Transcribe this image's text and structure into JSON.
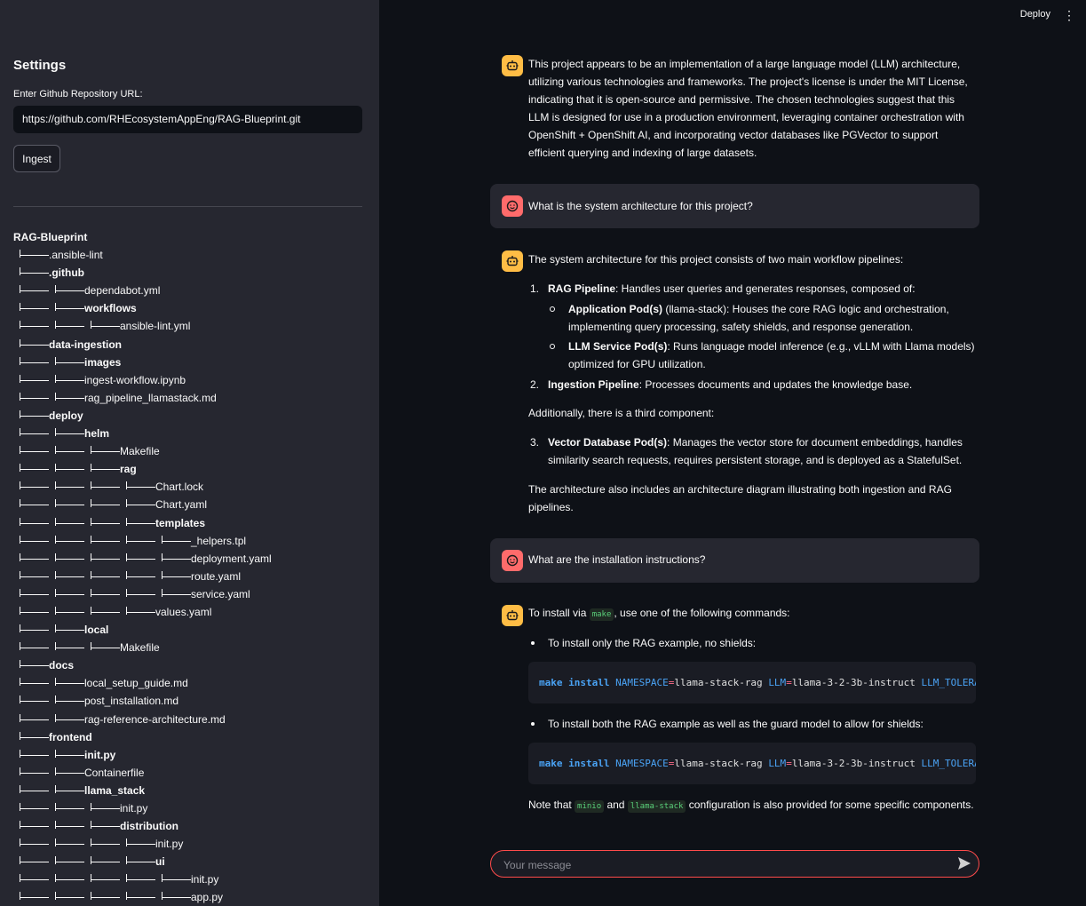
{
  "sidebar": {
    "title": "Settings",
    "repo_label": "Enter Github Repository URL:",
    "repo_url": "https://github.com/RHEcosystemAppEng/RAG-Blueprint.git",
    "ingest_label": "Ingest",
    "tree": [
      {
        "depth": 0,
        "name": "RAG-Blueprint",
        "bold": true
      },
      {
        "depth": 1,
        "name": ".ansible-lint",
        "bold": false
      },
      {
        "depth": 1,
        "name": ".github",
        "bold": true
      },
      {
        "depth": 2,
        "name": "dependabot.yml",
        "bold": false
      },
      {
        "depth": 2,
        "name": "workflows",
        "bold": true
      },
      {
        "depth": 3,
        "name": "ansible-lint.yml",
        "bold": false
      },
      {
        "depth": 1,
        "name": "data-ingestion",
        "bold": true
      },
      {
        "depth": 2,
        "name": "images",
        "bold": true
      },
      {
        "depth": 2,
        "name": "ingest-workflow.ipynb",
        "bold": false
      },
      {
        "depth": 2,
        "name": "rag_pipeline_llamastack.md",
        "bold": false
      },
      {
        "depth": 1,
        "name": "deploy",
        "bold": true
      },
      {
        "depth": 2,
        "name": "helm",
        "bold": true
      },
      {
        "depth": 3,
        "name": "Makefile",
        "bold": false
      },
      {
        "depth": 3,
        "name": "rag",
        "bold": true
      },
      {
        "depth": 4,
        "name": "Chart.lock",
        "bold": false
      },
      {
        "depth": 4,
        "name": "Chart.yaml",
        "bold": false
      },
      {
        "depth": 4,
        "name": "templates",
        "bold": true
      },
      {
        "depth": 5,
        "name": "_helpers.tpl",
        "bold": false
      },
      {
        "depth": 5,
        "name": "deployment.yaml",
        "bold": false
      },
      {
        "depth": 5,
        "name": "route.yaml",
        "bold": false
      },
      {
        "depth": 5,
        "name": "service.yaml",
        "bold": false
      },
      {
        "depth": 4,
        "name": "values.yaml",
        "bold": false
      },
      {
        "depth": 2,
        "name": "local",
        "bold": true
      },
      {
        "depth": 3,
        "name": "Makefile",
        "bold": false
      },
      {
        "depth": 1,
        "name": "docs",
        "bold": true
      },
      {
        "depth": 2,
        "name": "local_setup_guide.md",
        "bold": false
      },
      {
        "depth": 2,
        "name": "post_installation.md",
        "bold": false
      },
      {
        "depth": 2,
        "name": "rag-reference-architecture.md",
        "bold": false
      },
      {
        "depth": 1,
        "name": "frontend",
        "bold": true
      },
      {
        "depth": 2,
        "name": "init.py",
        "bold": true
      },
      {
        "depth": 2,
        "name": "Containerfile",
        "bold": false
      },
      {
        "depth": 2,
        "name": "llama_stack",
        "bold": true
      },
      {
        "depth": 3,
        "name": "init.py",
        "bold": false
      },
      {
        "depth": 3,
        "name": "distribution",
        "bold": true
      },
      {
        "depth": 4,
        "name": "init.py",
        "bold": false
      },
      {
        "depth": 4,
        "name": "ui",
        "bold": true
      },
      {
        "depth": 5,
        "name": "init.py",
        "bold": false
      },
      {
        "depth": 5,
        "name": "app.py",
        "bold": false
      }
    ]
  },
  "header": {
    "deploy_label": "Deploy",
    "menu_glyph": "⋮"
  },
  "colors": {
    "accent": "#ff4b4b",
    "bot_avatar": "#ffbd45",
    "user_avatar": "#ff6b6b"
  },
  "chat": {
    "msg1": "This project appears to be an implementation of a large language model (LLM) architecture, utilizing various technologies and frameworks. The project's license is under the MIT License, indicating that it is open-source and permissive. The chosen technologies suggest that this LLM is designed for use in a production environment, leveraging container orchestration with OpenShift + OpenShift AI, and incorporating vector databases like PGVector to support efficient querying and indexing of large datasets.",
    "q1": "What is the system architecture for this project?",
    "a2": {
      "intro": "The system architecture for this project consists of two main workflow pipelines:",
      "item1_num": "1.",
      "item1_title": "RAG Pipeline",
      "item1_text": ": Handles user queries and generates responses, composed of:",
      "sub1_title": "Application Pod(s)",
      "sub1_text": " (llama-stack): Houses the core RAG logic and orchestration, implementing query processing, safety shields, and response generation.",
      "sub2_title": "LLM Service Pod(s)",
      "sub2_text": ": Runs language model inference (e.g., vLLM with Llama models) optimized for GPU utilization.",
      "item2_num": "2.",
      "item2_title": "Ingestion Pipeline",
      "item2_text": ": Processes documents and updates the knowledge base.",
      "additional": "Additionally, there is a third component:",
      "item3_num": "3.",
      "item3_title": "Vector Database Pod(s)",
      "item3_text": ": Manages the vector store for document embeddings, handles similarity search requests, requires persistent storage, and is deployed as a StatefulSet.",
      "closing": "The architecture also includes an architecture diagram illustrating both ingestion and RAG pipelines."
    },
    "q2": "What are the installation instructions?",
    "a3": {
      "intro_pre": "To install via ",
      "intro_code": "make",
      "intro_post": ", use one of the following commands:",
      "bullet1": "To install only the RAG example, no shields:",
      "code1": {
        "kw": "make install",
        "v1": "NAMESPACE",
        "eq1": "=",
        "t1": "llama-stack-rag ",
        "v2": "LLM",
        "eq2": "=",
        "t2": "llama-3-2-3b-instruct ",
        "v3": "LLM_TOLERATION"
      },
      "bullet2": "To install both the RAG example as well as the guard model to allow for shields:",
      "code2": {
        "kw": "make install",
        "v1": "NAMESPACE",
        "eq1": "=",
        "t1": "llama-stack-rag ",
        "v2": "LLM",
        "eq2": "=",
        "t2": "llama-3-2-3b-instruct ",
        "v3": "LLM_TOLERATION"
      },
      "note_pre": "Note that ",
      "note_code1": "minio",
      "note_mid": " and ",
      "note_code2": "llama-stack",
      "note_post": " configuration is also provided for some specific components."
    },
    "input_placeholder": "Your message"
  }
}
